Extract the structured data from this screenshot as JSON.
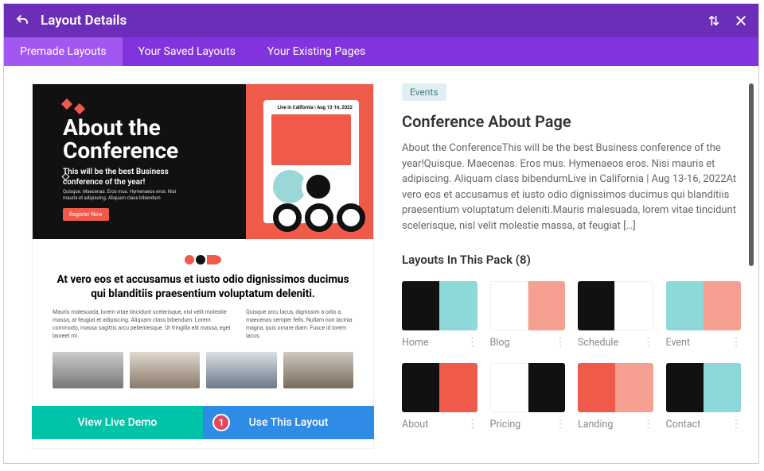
{
  "header": {
    "title": "Layout Details"
  },
  "tabs": [
    {
      "label": "Premade Layouts",
      "active": true
    },
    {
      "label": "Your Saved Layouts",
      "active": false
    },
    {
      "label": "Your Existing Pages",
      "active": false
    }
  ],
  "preview": {
    "heading_line1": "About the",
    "heading_line2": "Conference",
    "subheading": "This will be the best Business conference of the year!",
    "blurb": "Quisque. Maecenas. Eros mus. Hymenaeos eros. Nisi mauris et adipiscing. Aliquam class bibendum",
    "register": "Register Now",
    "card_caption": "Live in California | Aug 13-16, 2022",
    "mid_heading": "At vero eos et accusamus et iusto odio dignissimos ducimus qui blanditiis praesentium voluptatum deleniti.",
    "col1": "Mauris malesuada, lorem vitae tincidunt scelerisque, nisl velit molestie massa, at feugiat et adipiscing. Aliquam class bibendum. Lorem commodo, massa sagittis arcu pellentesque. Ut fringilla elit massa, eget laoreet mi.",
    "col2": "Quisque arcu lacus, dignissim a odio a, maecenas semper fells. Nullam non lacinia magna, quis ornare diam. Fusce id lorem lacus."
  },
  "actions": {
    "demo": "View Live Demo",
    "use": "Use This Layout",
    "marker": "1"
  },
  "details": {
    "tag": "Events",
    "title": "Conference About Page",
    "description": "About the ConferenceThis will be the best Business conference of the year!Quisque. Maecenas. Eros mus. Hymenaeos eros. Nisi mauris et adipiscing. Aliquam class bibendumLive in California | Aug 13-16, 2022At vero eos et accusamus et iusto odio dignissimos ducimus qui blanditiis praesentium voluptatum deleniti.Mauris malesuada, lorem vitae tincidunt scelerisque, nisl velit molestie massa, at feugiat […]",
    "pack_title": "Layouts In This Pack (8)",
    "packs": [
      {
        "name": "Home"
      },
      {
        "name": "Blog"
      },
      {
        "name": "Schedule"
      },
      {
        "name": "Event"
      },
      {
        "name": "About"
      },
      {
        "name": "Pricing"
      },
      {
        "name": "Landing"
      },
      {
        "name": "Contact"
      }
    ]
  }
}
